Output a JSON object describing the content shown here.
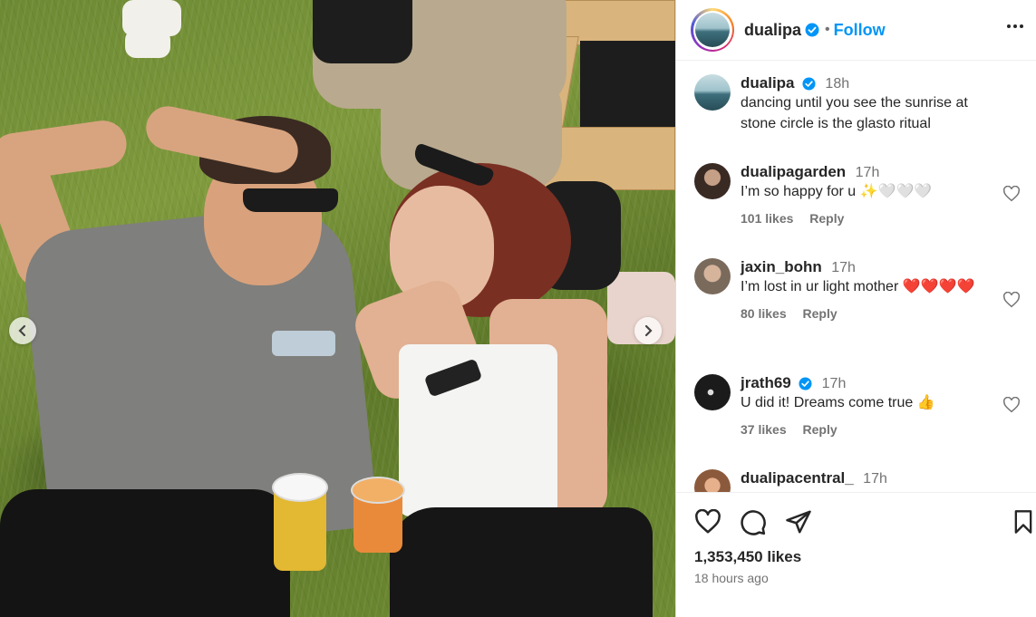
{
  "post": {
    "username": "dualipa",
    "follow_label": "Follow",
    "separator": "•",
    "caption": {
      "username": "dualipa",
      "time": "18h",
      "text": "dancing until you see the sunrise at stone circle is the glasto ritual"
    },
    "likes_count": "1,353,450 likes",
    "time_ago": "18 hours ago"
  },
  "comments": [
    {
      "username": "dualipagarden",
      "time": "17h",
      "text": "I’m so happy for u ✨🤍🤍🤍",
      "likes": "101 likes",
      "reply_label": "Reply",
      "verified": false
    },
    {
      "username": "jaxin_bohn",
      "time": "17h",
      "text": "I’m lost in ur light mother ❤️❤️❤️❤️",
      "likes": "80 likes",
      "reply_label": "Reply",
      "verified": false
    },
    {
      "username": "jrath69",
      "time": "17h",
      "text": "U did it! Dreams come true 👍",
      "likes": "37 likes",
      "reply_label": "Reply",
      "verified": true
    },
    {
      "username": "dualipacentral_",
      "time": "17h",
      "text": "",
      "likes": "",
      "reply_label": "",
      "verified": false
    }
  ],
  "icons": {
    "verified": "verified-badge-icon",
    "more": "more-options-icon",
    "like": "heart-icon",
    "comment": "comment-icon",
    "share": "share-icon",
    "save": "bookmark-icon",
    "prev": "chevron-left-icon",
    "next": "chevron-right-icon"
  },
  "colors": {
    "accent": "#0095f6",
    "muted": "#737373",
    "text": "#262626"
  }
}
